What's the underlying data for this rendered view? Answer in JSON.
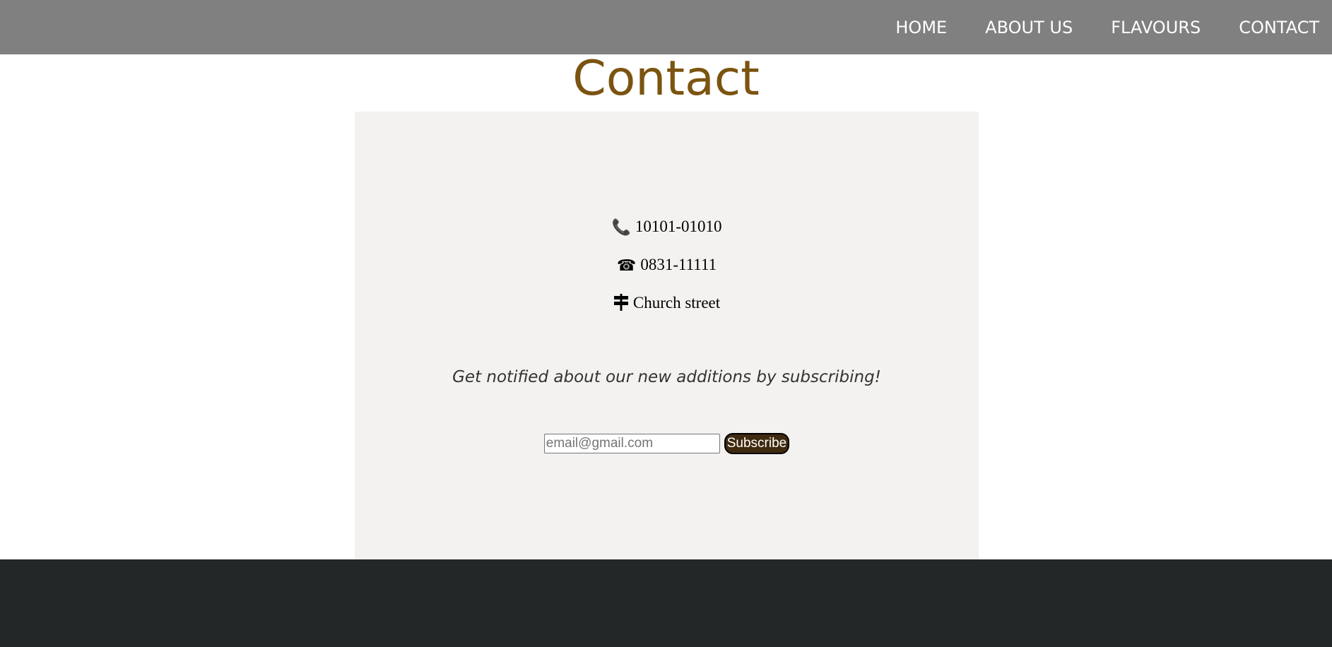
{
  "nav": {
    "items": [
      {
        "label": "HOME"
      },
      {
        "label": "ABOUT US"
      },
      {
        "label": "FLAVOURS"
      },
      {
        "label": "CONTACT"
      }
    ]
  },
  "page": {
    "title": "Contact"
  },
  "contact": {
    "phone": {
      "icon": "phone-icon",
      "glyph": "📞",
      "text": "10101-01010"
    },
    "landline": {
      "icon": "telephone-icon",
      "glyph": "☎",
      "text": "0831-11111"
    },
    "address": {
      "icon": "signpost-icon",
      "glyph": "⚐",
      "text": "Church street"
    }
  },
  "subscribe": {
    "note": "Get notified about our new additions by subscribing!",
    "email_placeholder": "email@gmail.com",
    "email_value": "",
    "button_label": "Subscribe"
  },
  "colors": {
    "navbar": "#808080",
    "title": "#7b5410",
    "panel": "#f3f2f0",
    "footer": "#242728",
    "button": "#3f2a10"
  }
}
